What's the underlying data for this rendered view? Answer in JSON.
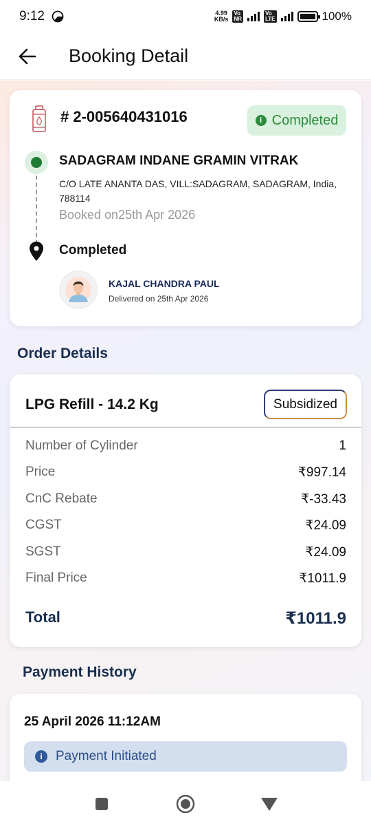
{
  "status_bar": {
    "time": "9:12",
    "net_speed": "4.99",
    "net_unit": "KB/s",
    "battery": "100%"
  },
  "header": {
    "title": "Booking Detail"
  },
  "booking": {
    "id": "# 2-005640431016",
    "status": "Completed",
    "vendor_name": "SADAGRAM INDANE GRAMIN VITRAK",
    "vendor_address": "C/O LATE ANANTA DAS, VILL:SADAGRAM, SADAGRAM, India, 788114",
    "booked_on": "Booked on25th Apr 2026",
    "delivery_status": "Completed",
    "delivery_person": "KAJAL CHANDRA PAUL",
    "delivered_on": "Delivered on 25th Apr 2026"
  },
  "order": {
    "section_title": "Order Details",
    "product": "LPG Refill - 14.2 Kg",
    "type": "Subsidized",
    "rows": [
      {
        "label": "Number of Cylinder",
        "value": "1"
      },
      {
        "label": "Price",
        "value": "₹997.14"
      },
      {
        "label": "CnC Rebate",
        "value": "₹-33.43"
      },
      {
        "label": "CGST",
        "value": "₹24.09"
      },
      {
        "label": "SGST",
        "value": "₹24.09"
      },
      {
        "label": "Final Price",
        "value": "₹1011.9"
      }
    ],
    "total_label": "Total",
    "total_value": "₹1011.9"
  },
  "payment": {
    "section_title": "Payment History",
    "date": "25 April 2026 11:12AM",
    "status": "Payment Initiated"
  },
  "icons": {
    "back": "arrow-left-icon",
    "cylinder": "gas-cylinder-icon",
    "pin": "location-pin-icon",
    "info": "info-icon"
  },
  "colors": {
    "success_bg": "#d9f1de",
    "success_text": "#2e8a3c",
    "heading": "#1a2f4f",
    "info_bg": "#d3deef",
    "info_text": "#2c4f86"
  }
}
